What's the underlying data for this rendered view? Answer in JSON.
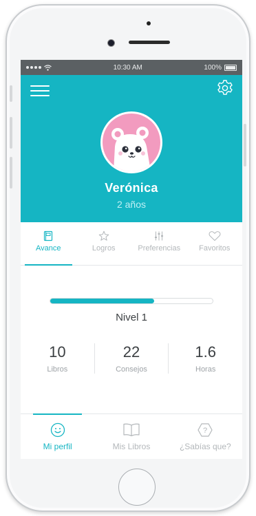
{
  "status_bar": {
    "time": "10:30 AM",
    "battery": "100%"
  },
  "profile": {
    "name": "Verónica",
    "age": "2 años"
  },
  "tabs": [
    {
      "label": "Avance",
      "icon": "notebook-icon",
      "active": true
    },
    {
      "label": "Logros",
      "icon": "star-icon",
      "active": false
    },
    {
      "label": "Preferencias",
      "icon": "sliders-icon",
      "active": false
    },
    {
      "label": "Favoritos",
      "icon": "heart-icon",
      "active": false
    }
  ],
  "progress": {
    "fraction": 0.64,
    "level_label": "Nivel 1"
  },
  "stats": [
    {
      "value": "10",
      "label": "Libros"
    },
    {
      "value": "22",
      "label": "Consejos"
    },
    {
      "value": "1.6",
      "label": "Horas"
    }
  ],
  "bottom_nav": [
    {
      "label": "Mi perfil",
      "icon": "smiley-icon",
      "active": true
    },
    {
      "label": "Mis Libros",
      "icon": "book-icon",
      "active": false
    },
    {
      "label": "¿Sabías que?",
      "icon": "question-icon",
      "active": false
    }
  ],
  "colors": {
    "accent": "#15b5c3",
    "avatar_bg": "#f29bbf",
    "status_bar": "#5b6063"
  }
}
